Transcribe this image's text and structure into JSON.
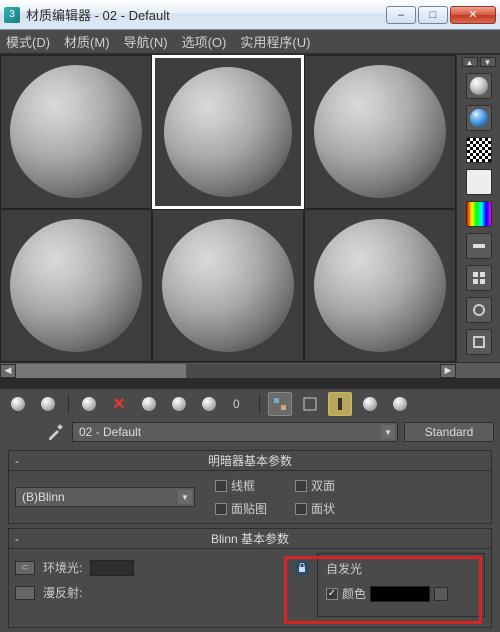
{
  "window": {
    "title": "材质编辑器 - 02 - Default"
  },
  "menu": {
    "mode": "模式(D)",
    "material": "材质(M)",
    "navigate": "导航(N)",
    "options": "选项(O)",
    "utility": "实用程序(U)"
  },
  "material_name": "02 - Default",
  "type_button": "Standard",
  "rollout1": {
    "title": "明暗器基本参数",
    "shader": "(B)Blinn",
    "wire": "线框",
    "two_sided": "双面",
    "face_map": "面贴图",
    "faceted": "面状"
  },
  "rollout2": {
    "title": "Blinn 基本参数",
    "ambient_label": "环境光:",
    "diffuse_label": "漫反射:",
    "self_illum_title": "自发光",
    "color_label": "颜色"
  }
}
